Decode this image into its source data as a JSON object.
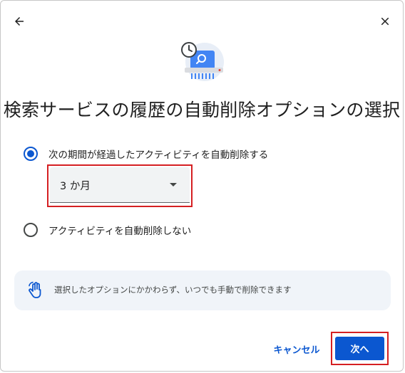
{
  "header": {
    "back_icon": "arrow-back-icon",
    "close_icon": "close-icon"
  },
  "illustration": {
    "icon": "history-search-shredder-icon"
  },
  "title": "検索サービスの履歴の自動削除オプションの選択",
  "options": [
    {
      "label": "次の期間が経過したアクティビティを自動削除する",
      "checked": true
    },
    {
      "label": "アクティビティを自動削除しない",
      "checked": false
    }
  ],
  "period_select": {
    "value": "3 か月"
  },
  "info": {
    "icon": "touch-hand-icon",
    "text": "選択したオプションにかかわらず、いつでも手動で削除できます"
  },
  "footer": {
    "cancel_label": "キャンセル",
    "next_label": "次へ"
  },
  "colors": {
    "accent": "#0b57d0",
    "highlight_border": "#d51f22",
    "info_bg": "#f0f4f9"
  }
}
